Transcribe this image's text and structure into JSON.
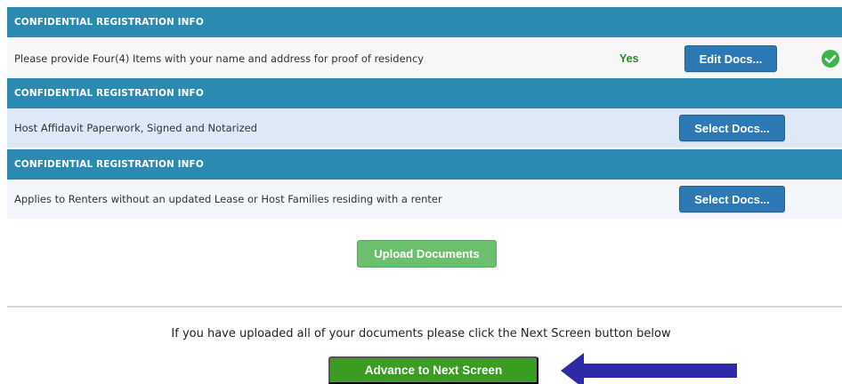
{
  "sections": [
    {
      "header": "CONFIDENTIAL REGISTRATION INFO",
      "description": "Please provide Four(4) Items with your name and address for proof of residency",
      "status": "Yes",
      "button_label": "Edit Docs...",
      "complete_icon": "check-circle-icon"
    },
    {
      "header": "CONFIDENTIAL REGISTRATION INFO",
      "description": "Host Affidavit Paperwork, Signed and Notarized",
      "button_label": "Select Docs..."
    },
    {
      "header": "CONFIDENTIAL REGISTRATION INFO",
      "description": "Applies to Renters without an updated Lease or Host Families residing with a renter",
      "button_label": "Select Docs..."
    }
  ],
  "upload_button": "Upload Documents",
  "instruction": "If you have uploaded all of your documents please click the Next Screen button below",
  "next_button": "Advance to Next Screen",
  "annotation": {
    "type": "arrow-left-icon",
    "color": "#2e2aa7"
  },
  "colors": {
    "header_bg": "#2b8ab1",
    "row_alt_bg": "#dde9f6",
    "doc_button": "#2d79b6",
    "status_yes": "#1f8a1f",
    "check_icon": "#3bb44a",
    "upload_button": "#6cbf6d",
    "next_button": "#3a9c20"
  }
}
